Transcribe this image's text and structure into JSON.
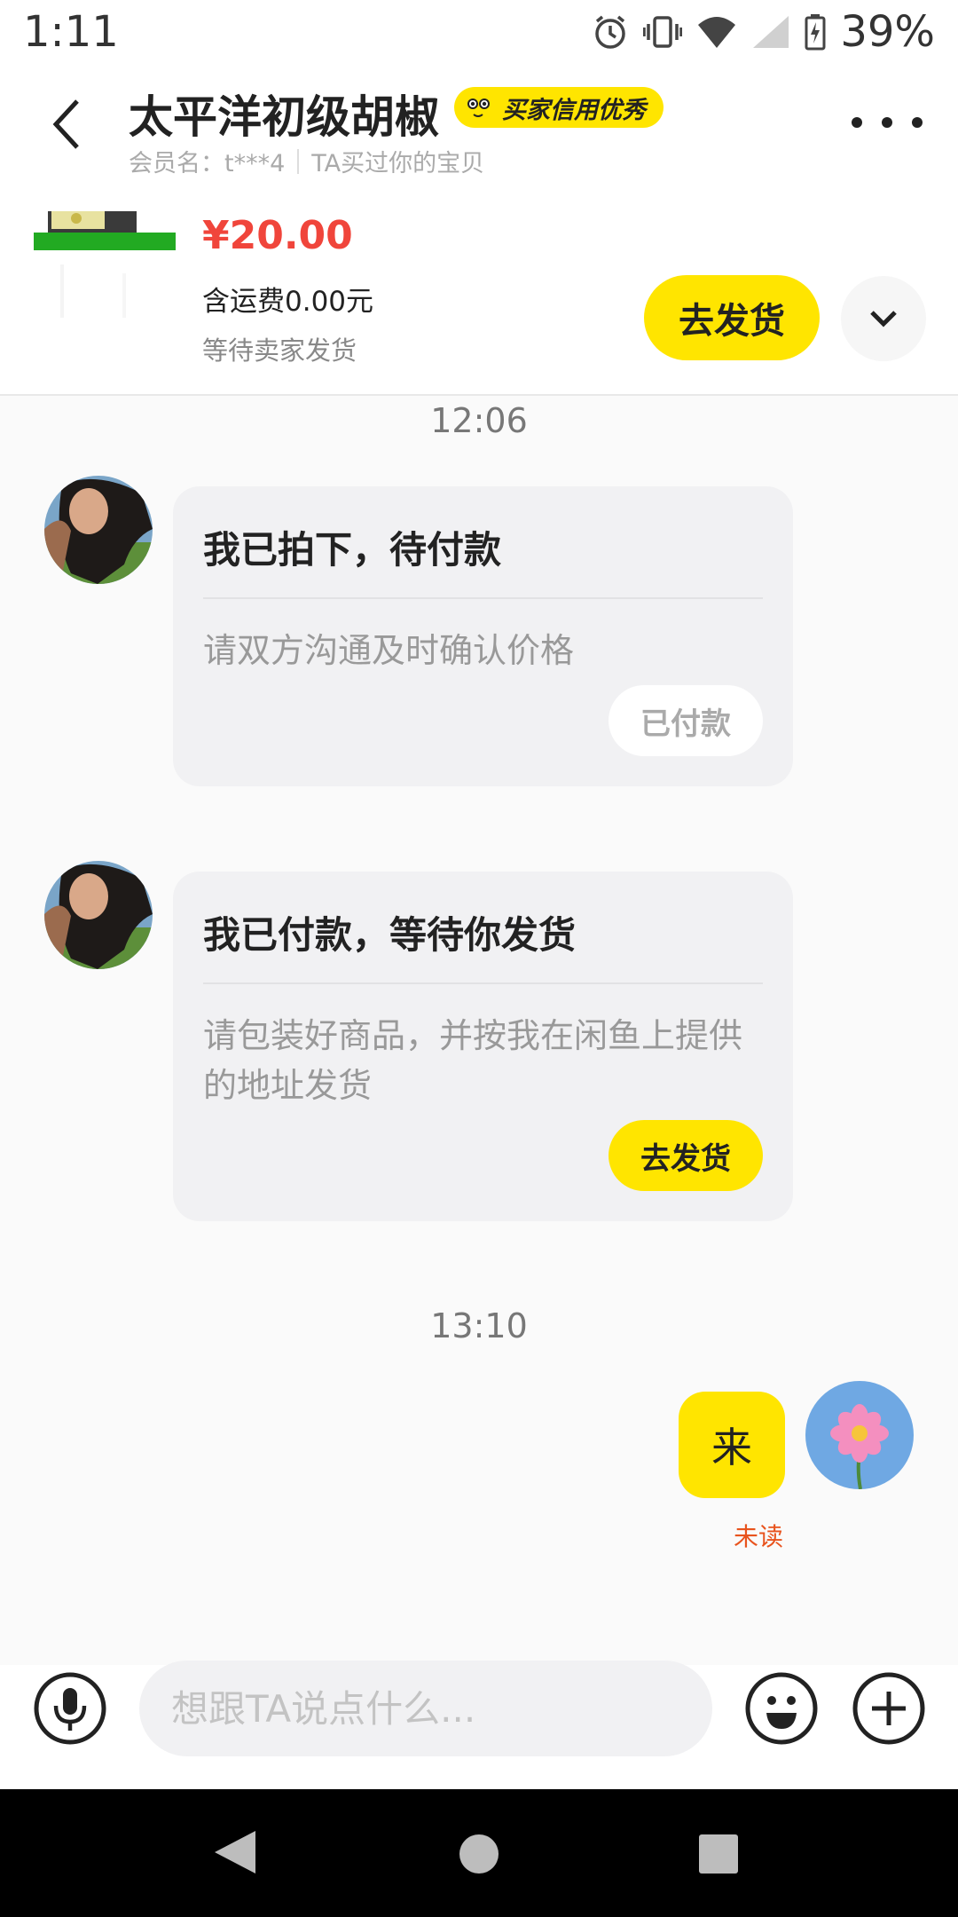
{
  "status_bar": {
    "time": "1:11",
    "battery": "39%"
  },
  "header": {
    "title": "太平洋初级胡椒",
    "badge": "买家信用优秀",
    "member_label": "会员名：t***4",
    "bought_label": "TA买过你的宝贝"
  },
  "product": {
    "price": "¥20.00",
    "shipping": "含运费0.00元",
    "status": "等待卖家发货",
    "ship_button": "去发货"
  },
  "chat": {
    "messages": [
      {
        "time": "12:06",
        "title": "我已拍下，待付款",
        "body": "请双方沟通及时确认价格",
        "button": "已付款"
      },
      {
        "title": "我已付款，等待你发货",
        "body": "请包装好商品，并按我在闲鱼上提供的地址发货",
        "button": "去发货"
      }
    ],
    "time2": "13:10",
    "my_message": "来",
    "my_status": "未读"
  },
  "input": {
    "placeholder": "想跟TA说点什么..."
  },
  "colors": {
    "accent": "#ffe500",
    "price": "#f0453b",
    "unread": "#e8531d"
  }
}
